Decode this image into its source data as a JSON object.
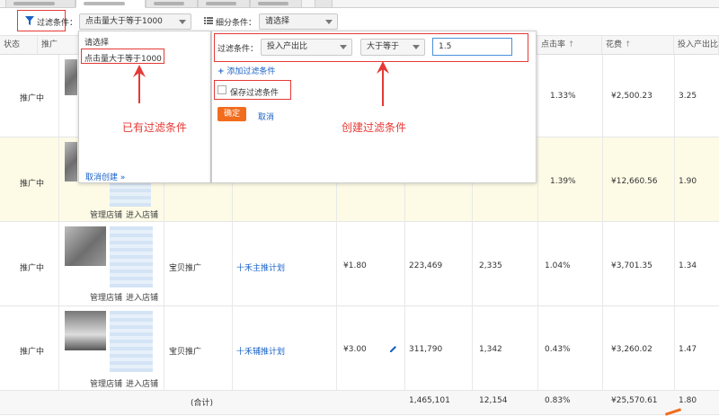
{
  "filterbar": {
    "filter_label": "过滤条件：",
    "filter_value": "点击量大于等于1000",
    "sub_label": "细分条件：",
    "sub_value": "请选择"
  },
  "table": {
    "headers": [
      "状态",
      "推广",
      "点击率",
      "花费",
      "投入产出比"
    ],
    "rows": [
      {
        "status": "推广中",
        "ctr": "1.33%",
        "cost": "¥2,500.23",
        "roi": "3.25"
      },
      {
        "status": "推广中",
        "shop_manage": "管理店铺",
        "shop_enter": "进入店铺",
        "ctr": "1.39%",
        "cost": "¥12,660.56",
        "roi": "1.90"
      },
      {
        "status": "推广中",
        "shop_manage": "管理店铺",
        "shop_enter": "进入店铺",
        "type": "宝贝推广",
        "plan": "十禾主推计划",
        "bid": "¥1.80",
        "impr": "223,469",
        "clicks": "2,335",
        "ctr": "1.04%",
        "cost": "¥3,701.35",
        "roi": "1.34"
      },
      {
        "status": "推广中",
        "shop_manage": "管理店铺",
        "shop_enter": "进入店铺",
        "type": "宝贝推广",
        "plan": "十禾辅推计划",
        "bid": "¥3.00",
        "impr": "311,790",
        "clicks": "1,342",
        "ctr": "0.43%",
        "cost": "¥3,260.02",
        "roi": "1.47"
      }
    ],
    "total": {
      "label": "(合计)",
      "impr": "1,465,101",
      "clicks": "12,154",
      "ctr": "0.83%",
      "cost": "¥25,570.61",
      "roi": "1.80"
    }
  },
  "saved_dropdown": {
    "placeholder": "请选择",
    "option": "点击量大于等于1000",
    "cancel": "取消创建 »"
  },
  "create_panel": {
    "label": "过滤条件：",
    "field": "投入产出比",
    "operator": "大于等于",
    "value": "1.5",
    "add": "添加过滤条件",
    "save": "保存过滤条件",
    "ok": "确定",
    "cancel": "取消"
  },
  "annotations": {
    "existing": "已有过滤条件",
    "create": "创建过滤条件"
  },
  "icons": [
    "filter-icon",
    "list-icon",
    "sort-arrow-icon",
    "edit-icon",
    "plus-icon"
  ],
  "colors": {
    "accent_red": "#e53935",
    "link_blue": "#1a62c6",
    "ok_orange": "#f26c1d",
    "highlight_row": "#fdfbe6"
  }
}
